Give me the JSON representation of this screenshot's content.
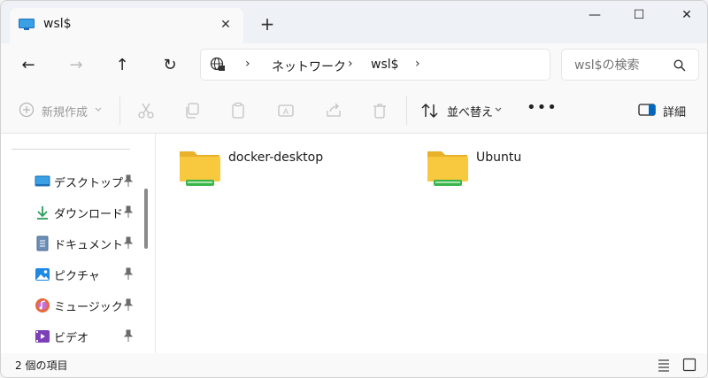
{
  "window": {
    "tab_title": "wsl$",
    "tab_close": "✕",
    "new_tab": "+",
    "minimize": "—",
    "maximize": "☐",
    "close": "✕"
  },
  "nav": {
    "back": "←",
    "forward": "→",
    "up": "↑",
    "refresh": "↻",
    "breadcrumb": [
      "ネットワーク",
      "wsl$"
    ],
    "separator": "›",
    "search_placeholder": "wsl$の検索"
  },
  "toolbar": {
    "new_label": "新規作成",
    "sort_label": "並べ替え",
    "more_label": "•••",
    "details_label": "詳細"
  },
  "sidebar": {
    "items": [
      {
        "label": "デスクトップ",
        "icon": "desktop-icon"
      },
      {
        "label": "ダウンロード",
        "icon": "download-icon"
      },
      {
        "label": "ドキュメント",
        "icon": "document-icon"
      },
      {
        "label": "ピクチャ",
        "icon": "picture-icon"
      },
      {
        "label": "ミュージック",
        "icon": "music-icon"
      },
      {
        "label": "ビデオ",
        "icon": "video-icon"
      }
    ]
  },
  "content": {
    "folders": [
      {
        "name": "docker-desktop"
      },
      {
        "name": "Ubuntu"
      }
    ]
  },
  "status": {
    "item_count": "2 個の項目"
  },
  "colors": {
    "accent": "#0067c0",
    "folder_yellow": "#f8c93f",
    "folder_green": "#3bb54a"
  }
}
